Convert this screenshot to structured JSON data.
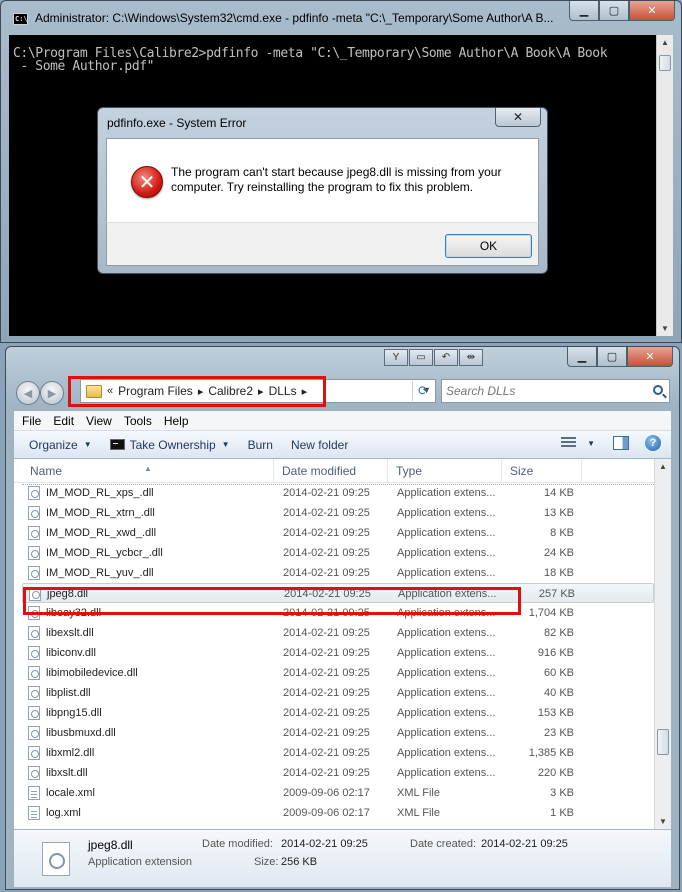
{
  "colors": {
    "highlight": "#e01010",
    "error_icon": "#d01a12",
    "cmd_bg": "#000000",
    "cmd_text": "#c0c0c0"
  },
  "cmd": {
    "title": "Administrator: C:\\Windows\\System32\\cmd.exe - pdfinfo  -meta \"C:\\_Temporary\\Some Author\\A B...",
    "line1": "C:\\Program Files\\Calibre2>pdfinfo -meta \"C:\\_Temporary\\Some Author\\A Book\\A Book",
    "line2": " - Some Author.pdf\""
  },
  "dialog": {
    "title": "pdfinfo.exe - System Error",
    "close_label": "✕",
    "message": "The program can't start because jpeg8.dll is missing from your computer. Try reinstalling the program to fix this problem.",
    "ok_label": "OK"
  },
  "explorer": {
    "breadcrumb": [
      "Program Files",
      "Calibre2",
      "DLLs"
    ],
    "breadcrumb_prefix": "«",
    "search_placeholder": "Search DLLs",
    "menu": [
      "File",
      "Edit",
      "View",
      "Tools",
      "Help"
    ],
    "commands": {
      "organize": "Organize",
      "take_ownership": "Take Ownership",
      "burn": "Burn",
      "new_folder": "New folder"
    },
    "columns": {
      "name": "Name",
      "date": "Date modified",
      "type": "Type",
      "size": "Size"
    },
    "files": [
      {
        "name": "IM_MOD_RL_xps_.dll",
        "date": "2014-02-21 09:25",
        "type": "Application extens...",
        "size": "14 KB",
        "icon": "dll"
      },
      {
        "name": "IM_MOD_RL_xtrn_.dll",
        "date": "2014-02-21 09:25",
        "type": "Application extens...",
        "size": "13 KB",
        "icon": "dll"
      },
      {
        "name": "IM_MOD_RL_xwd_.dll",
        "date": "2014-02-21 09:25",
        "type": "Application extens...",
        "size": "8 KB",
        "icon": "dll"
      },
      {
        "name": "IM_MOD_RL_ycbcr_.dll",
        "date": "2014-02-21 09:25",
        "type": "Application extens...",
        "size": "24 KB",
        "icon": "dll"
      },
      {
        "name": "IM_MOD_RL_yuv_.dll",
        "date": "2014-02-21 09:25",
        "type": "Application extens...",
        "size": "18 KB",
        "icon": "dll"
      },
      {
        "name": "jpeg8.dll",
        "date": "2014-02-21 09:25",
        "type": "Application extens...",
        "size": "257 KB",
        "icon": "dll",
        "selected": true
      },
      {
        "name": "libeay32.dll",
        "date": "2014-02-21 09:25",
        "type": "Application extens...",
        "size": "1,704 KB",
        "icon": "dll"
      },
      {
        "name": "libexslt.dll",
        "date": "2014-02-21 09:25",
        "type": "Application extens...",
        "size": "82 KB",
        "icon": "dll"
      },
      {
        "name": "libiconv.dll",
        "date": "2014-02-21 09:25",
        "type": "Application extens...",
        "size": "916 KB",
        "icon": "dll"
      },
      {
        "name": "libimobiledevice.dll",
        "date": "2014-02-21 09:25",
        "type": "Application extens...",
        "size": "60 KB",
        "icon": "dll"
      },
      {
        "name": "libplist.dll",
        "date": "2014-02-21 09:25",
        "type": "Application extens...",
        "size": "40 KB",
        "icon": "dll"
      },
      {
        "name": "libpng15.dll",
        "date": "2014-02-21 09:25",
        "type": "Application extens...",
        "size": "153 KB",
        "icon": "dll"
      },
      {
        "name": "libusbmuxd.dll",
        "date": "2014-02-21 09:25",
        "type": "Application extens...",
        "size": "23 KB",
        "icon": "dll"
      },
      {
        "name": "libxml2.dll",
        "date": "2014-02-21 09:25",
        "type": "Application extens...",
        "size": "1,385 KB",
        "icon": "dll"
      },
      {
        "name": "libxslt.dll",
        "date": "2014-02-21 09:25",
        "type": "Application extens...",
        "size": "220 KB",
        "icon": "dll"
      },
      {
        "name": "locale.xml",
        "date": "2009-09-06 02:17",
        "type": "XML File",
        "size": "3 KB",
        "icon": "xml"
      },
      {
        "name": "log.xml",
        "date": "2009-09-06 02:17",
        "type": "XML File",
        "size": "1 KB",
        "icon": "xml"
      }
    ],
    "details": {
      "name": "jpeg8.dll",
      "type": "Application extension",
      "date_modified_label": "Date modified:",
      "date_modified": "2014-02-21 09:25",
      "date_created_label": "Date created:",
      "date_created": "2014-02-21 09:25",
      "size_label": "Size:",
      "size": "256 KB"
    }
  }
}
